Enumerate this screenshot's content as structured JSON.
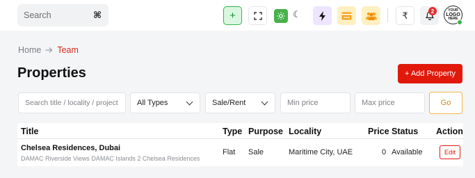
{
  "header": {
    "search_placeholder": "Search",
    "search_shortcut_icon": "command-key-icon",
    "add_icon": "plus-icon",
    "fullscreen_icon": "fullscreen-icon",
    "theme_light_icon": "sun-icon",
    "theme_dark_icon": "moon-icon",
    "bolt_icon": "bolt-icon",
    "card_icon": "card-icon",
    "team_icon": "team-icon",
    "currency_symbol": "₹",
    "notification_count": "2",
    "logo_text": [
      "YOUR",
      "LOGO",
      "HERE"
    ],
    "accent_color": "#e0190b",
    "success_color": "#37b24d"
  },
  "breadcrumb": {
    "home": "Home",
    "current": "Team"
  },
  "page": {
    "title": "Properties",
    "add_button": "+ Add Property"
  },
  "filters": {
    "search_placeholder": "Search title / locality / project",
    "type_selected": "All Types",
    "sale_selected": "Sale/Rent",
    "min_price_placeholder": "Min price",
    "max_price_placeholder": "Max price",
    "go_label": "Go"
  },
  "table": {
    "columns": [
      "Title",
      "Type",
      "Purpose",
      "Locality",
      "Price",
      "Status",
      "Action"
    ],
    "rows": [
      {
        "title": "Chelsea Residences, Dubai",
        "subtitle": "DAMAC Riverside Views DAMAC Islands 2 Chelsea Residences",
        "type": "Flat",
        "purpose": "Sale",
        "locality": "Maritime City, UAE",
        "price": "0",
        "status": "Available",
        "action": "Edit"
      }
    ]
  }
}
